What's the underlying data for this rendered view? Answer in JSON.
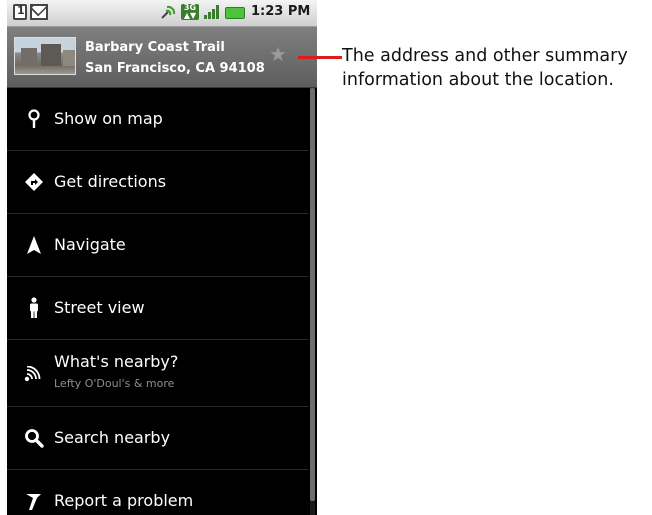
{
  "status_bar": {
    "time": "1:23 PM",
    "icons": [
      "sim-icon",
      "mail-icon",
      "gps-icon",
      "network-3g-icon",
      "signal-icon",
      "battery-icon"
    ]
  },
  "header": {
    "title": "Barbary Coast Trail",
    "address": "San Francisco, CA 94108",
    "star_icon": "star-icon"
  },
  "menu": {
    "items": [
      {
        "label": "Show on map",
        "icon": "map-pin-icon"
      },
      {
        "label": "Get directions",
        "icon": "directions-icon"
      },
      {
        "label": "Navigate",
        "icon": "navigate-arrow-icon"
      },
      {
        "label": "Street view",
        "icon": "street-view-person-icon"
      },
      {
        "label": "What's nearby?",
        "sub": "Lefty O'Doul's & more",
        "icon": "nearby-icon"
      },
      {
        "label": "Search nearby",
        "icon": "search-icon"
      },
      {
        "label": "Report a problem",
        "icon": "report-flag-icon"
      }
    ]
  },
  "callout": {
    "line1": "The address and other summary",
    "line2": "information about the location."
  },
  "colors": {
    "callout_line": "#d81e1e",
    "menu_background": "#000000",
    "header_background": "#6e6e6e",
    "battery": "#4cc33a"
  }
}
